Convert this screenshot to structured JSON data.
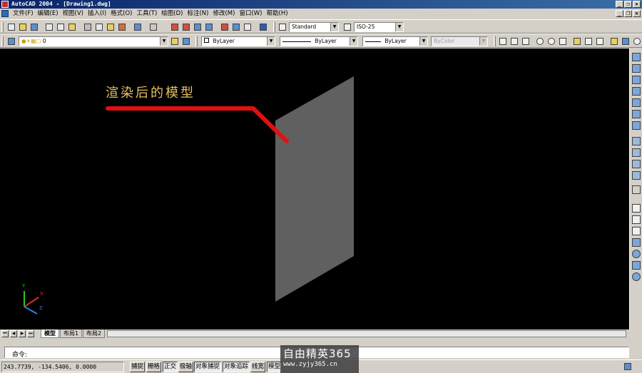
{
  "window": {
    "title": "AutoCAD 2004 - [Drawing1.dwg]"
  },
  "menu": [
    "文件(F)",
    "编辑(E)",
    "视图(V)",
    "插入(I)",
    "格式(O)",
    "工具(T)",
    "绘图(D)",
    "标注(N)",
    "修改(M)",
    "窗口(W)",
    "帮助(H)"
  ],
  "toolbar": {
    "text_style": "Standard",
    "dim_style": "ISO-25"
  },
  "properties": {
    "layer": "0",
    "color": "ByLayer",
    "linetype": "ByLayer",
    "lineweight": "ByLayer",
    "plot_style": "ByColor"
  },
  "annotation": {
    "text": "渲染后的模型",
    "color": "#e8c060",
    "arrow_color": "#e01010"
  },
  "model": {
    "face_color": "#606060"
  },
  "ucs": {
    "x": "X",
    "y": "Y",
    "z": "Z"
  },
  "tabs": [
    "模型",
    "布局1",
    "布局2"
  ],
  "command": {
    "prompt": "命令:"
  },
  "status": {
    "coords": "243.7739,  -134.5406,  0.0000",
    "buttons": [
      "捕捉",
      "栅格",
      "正交",
      "极轴",
      "对象捕捉",
      "对象追踪",
      "线宽",
      "模型"
    ]
  },
  "watermark": {
    "title": "自由精英365",
    "url": "www.zyjy365.cn"
  }
}
